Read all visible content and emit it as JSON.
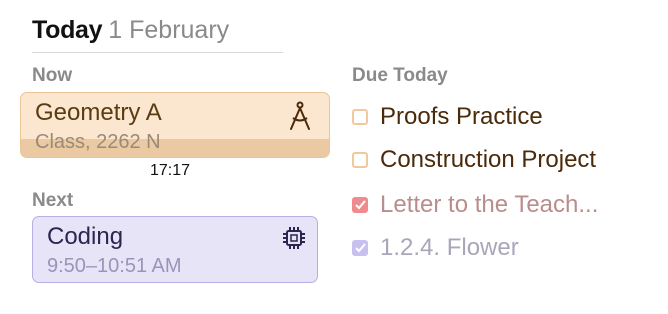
{
  "header": {
    "title": "Today",
    "date": "1 February"
  },
  "now": {
    "section_label": "Now",
    "card": {
      "title": "Geometry A",
      "subtitle": "Class, 2262 N",
      "icon": "compass-icon",
      "progress": 1.0,
      "color": "#fbe6cf"
    },
    "time": "17:17"
  },
  "next": {
    "section_label": "Next",
    "card": {
      "title": "Coding",
      "subtitle": "9:50–10:51 AM",
      "icon": "chip-icon",
      "color": "#e8e4f8"
    }
  },
  "due_today": {
    "section_label": "Due Today",
    "tasks": [
      {
        "label": "Proofs Practice",
        "done": false
      },
      {
        "label": "Construction Project",
        "done": false
      },
      {
        "label": "Letter to the Teach...",
        "done": true,
        "color": "#ef8b8e"
      },
      {
        "label": "1.2.4. Flower",
        "done": true,
        "color": "#c8c1f0"
      }
    ]
  }
}
